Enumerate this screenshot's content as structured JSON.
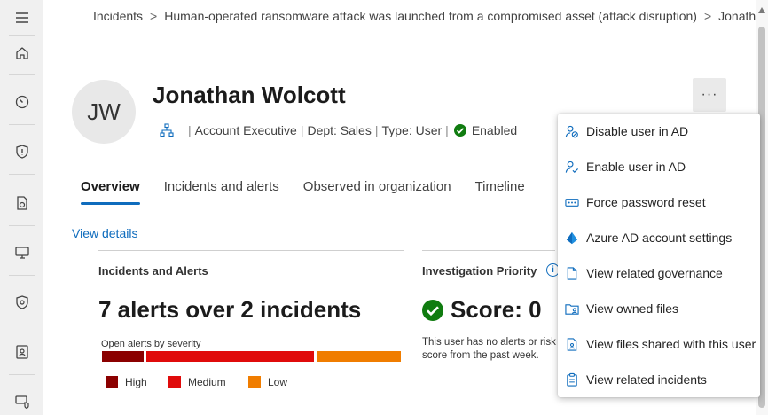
{
  "breadcrumb": {
    "items": [
      "Incidents",
      "Human-operated ransomware attack was launched from a compromised asset (attack disruption)",
      "Jonath"
    ],
    "separator": ">"
  },
  "rail": {
    "icons": [
      "menu-icon",
      "home-icon",
      "gauge-icon",
      "shield-icon",
      "file-lock-icon",
      "devices-icon",
      "security-check-icon",
      "identity-icon",
      "device-shield-icon"
    ]
  },
  "user": {
    "initials": "JW",
    "name": "Jonathan Wolcott",
    "title": "Account Executive",
    "dept": "Dept: Sales",
    "type": "Type: User",
    "status": "Enabled"
  },
  "more_button": "···",
  "tabs": [
    {
      "label": "Overview",
      "active": true
    },
    {
      "label": "Incidents and alerts",
      "active": false
    },
    {
      "label": "Observed in organization",
      "active": false
    },
    {
      "label": "Timeline",
      "active": false
    }
  ],
  "view_details": "View details",
  "incidents_card": {
    "title": "Incidents and Alerts",
    "stat": "7 alerts over 2 incidents",
    "severity_label": "Open alerts by severity",
    "legend": [
      {
        "label": "High",
        "color": "#8b0000"
      },
      {
        "label": "Medium",
        "color": "#e00b0b"
      },
      {
        "label": "Low",
        "color": "#f07d00"
      }
    ]
  },
  "priority_card": {
    "title": "Investigation Priority",
    "score": "Score: 0",
    "description": "This user has no alerts or risk score from the past week."
  },
  "menu": {
    "items": [
      {
        "label": "Disable user in AD",
        "icon": "user-block-icon"
      },
      {
        "label": "Enable user in AD",
        "icon": "user-check-icon"
      },
      {
        "label": "Force password reset",
        "icon": "password-icon"
      },
      {
        "label": "Azure AD account settings",
        "icon": "azure-ad-icon"
      },
      {
        "label": "View related governance",
        "icon": "document-icon"
      },
      {
        "label": "View owned files",
        "icon": "folder-user-icon"
      },
      {
        "label": "View files shared with this user",
        "icon": "file-shared-icon"
      },
      {
        "label": "View related incidents",
        "icon": "clipboard-icon"
      }
    ]
  },
  "colors": {
    "accent": "#0f6cbd",
    "success": "#107c10",
    "high": "#8b0000",
    "medium": "#e00b0b",
    "low": "#f07d00"
  }
}
